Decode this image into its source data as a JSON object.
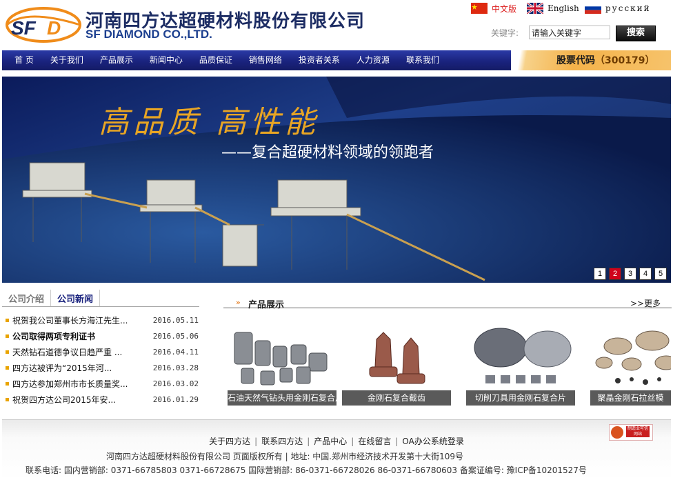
{
  "header": {
    "company_cn": "河南四方达超硬材料股份有限公司",
    "company_en": "SF DIAMOND CO.,LTD.",
    "logo_text": "SFD",
    "languages": [
      {
        "label": "中文版",
        "flag": "china-flag-icon"
      },
      {
        "label": "English",
        "flag": "uk-flag-icon"
      },
      {
        "label": "русский",
        "flag": "russia-flag-icon"
      }
    ],
    "search": {
      "label": "关键字:",
      "placeholder": "请输入关键字",
      "value": "请输入关键字",
      "button": "搜索"
    }
  },
  "nav": {
    "items": [
      "首 页",
      "关于我们",
      "产品展示",
      "新闻中心",
      "品质保证",
      "销售网络",
      "投资者关系",
      "人力资源",
      "联系我们"
    ],
    "stock_label": "股票代码",
    "stock_code": "（300179）"
  },
  "banner": {
    "slogan_1": "高品质  高性能",
    "slogan_2": "——复合超硬材料领域的领跑者",
    "slides": [
      "1",
      "2",
      "3",
      "4",
      "5"
    ],
    "active_slide": 2
  },
  "news": {
    "tabs": [
      "公司介绍",
      "公司新闻"
    ],
    "items": [
      {
        "title": "祝贺我公司董事长方海江先生...",
        "date": "2016.05.11",
        "bold": false
      },
      {
        "title": "公司取得两项专利证书",
        "date": "2016.05.06",
        "bold": true
      },
      {
        "title": "天然钻石道德争议日趋严重 ...",
        "date": "2016.04.11",
        "bold": false
      },
      {
        "title": "四方达被评为“2015年河...",
        "date": "2016.03.28",
        "bold": false
      },
      {
        "title": "四方达参加郑州市市长质量奖...",
        "date": "2016.03.02",
        "bold": false
      },
      {
        "title": "祝贺四方达公司2015年安...",
        "date": "2016.01.29",
        "bold": false
      }
    ]
  },
  "products": {
    "title": "产品展示",
    "more": ">>更多",
    "items": [
      "石油天然气钻头用金刚石复合片",
      "金刚石复合截齿",
      "切削刀具用金刚石复合片",
      "聚晶金刚石拉丝模"
    ]
  },
  "footer": {
    "links": [
      "关于四方达",
      "联系四方达",
      "产品中心",
      "在线留言",
      "OA办公系统登录"
    ],
    "line2": "河南四方达超硬材料股份有限公司 页面版权所有 | 地址: 中国.郑州市经济技术开发第十大街109号",
    "line3": "联系电话: 国内营销部: 0371-66785803 0371-66728675 国际营销部: 86-0371-66728026 86-0371-66780603 备案证编号: 豫ICP备10201527号",
    "badge": "制造业可信网站"
  },
  "colors": {
    "nav_blue": "#1a237e",
    "brand_orange": "#f08c1a",
    "accent_gold": "#e8a524",
    "active_red": "#d0021b"
  }
}
